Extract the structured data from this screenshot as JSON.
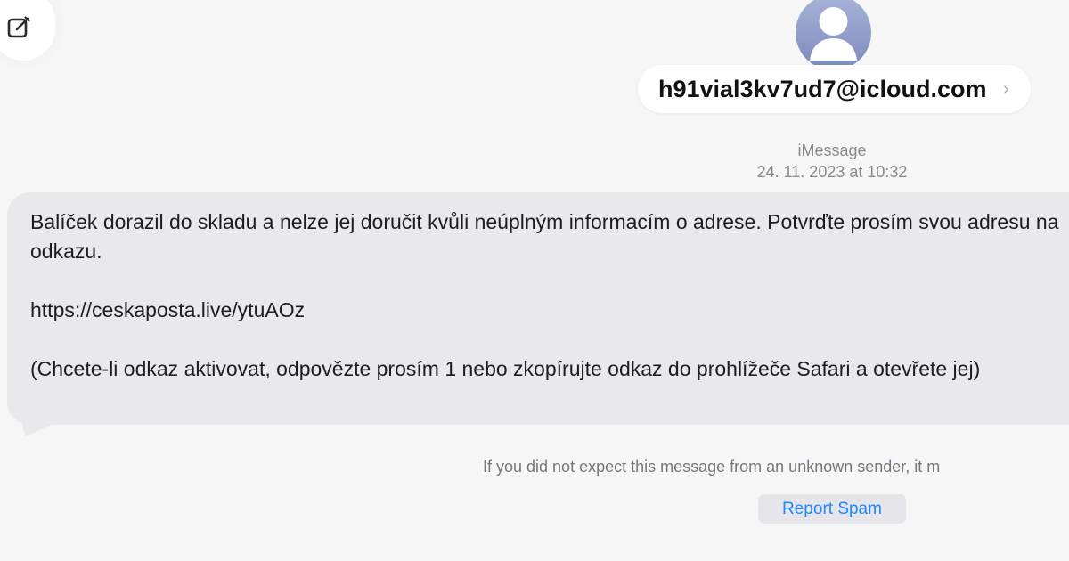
{
  "toolbar": {
    "compose_icon": "compose-icon"
  },
  "contact": {
    "avatar_icon": "person-icon",
    "name": "h91vial3kv7ud7@icloud.com",
    "chevron": "›"
  },
  "conversation": {
    "service": "iMessage",
    "timestamp": "24. 11. 2023 at 10:32",
    "message": {
      "paragraphs": [
        "Balíček dorazil do skladu a nelze jej doručit kvůli neúplným informacím o adrese. Potvrďte prosím svou adresu na odkazu.",
        "https://ceskaposta.live/ytuAOz",
        "(Chcete-li odkaz aktivovat, odpovězte prosím 1 nebo zkopírujte odkaz do prohlížeče Safari a otevřete jej)"
      ]
    },
    "unknown_sender_note": "If you did not expect this message from an unknown sender, it m",
    "report_spam_label": "Report Spam"
  },
  "colors": {
    "background": "#f6f6f6",
    "bubble": "#e9e9eb",
    "link_blue": "#1d88ff",
    "muted_text": "#8a8a8e"
  }
}
